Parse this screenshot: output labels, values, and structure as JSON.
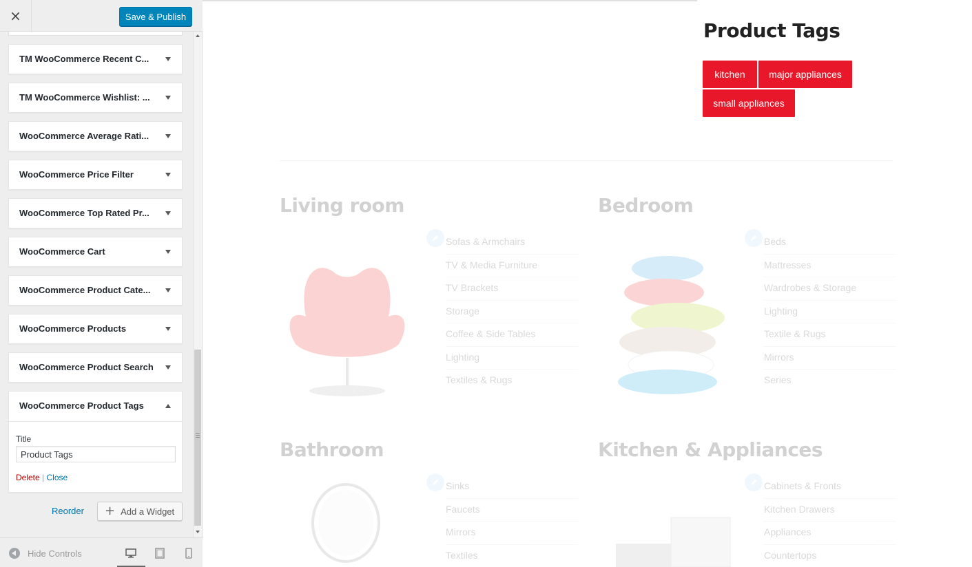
{
  "topbar": {
    "close_glyph": "×",
    "publish_label": "Save & Publish"
  },
  "widgets": [
    {
      "title": "TM WooCommerce Recent C..."
    },
    {
      "title": "TM WooCommerce Wishlist: ..."
    },
    {
      "title": "WooCommerce Average Rati..."
    },
    {
      "title": "WooCommerce Price Filter"
    },
    {
      "title": "WooCommerce Top Rated Pr..."
    },
    {
      "title": "WooCommerce Cart"
    },
    {
      "title": "WooCommerce Product Cate..."
    },
    {
      "title": "WooCommerce Products"
    },
    {
      "title": "WooCommerce Product Search"
    }
  ],
  "open_widget": {
    "title": "WooCommerce Product Tags",
    "field_label": "Title",
    "field_value": "Product Tags",
    "delete_label": "Delete",
    "separator": "|",
    "close_label": "Close"
  },
  "actions": {
    "reorder_label": "Reorder",
    "add_widget_label": "Add a Widget"
  },
  "footer": {
    "hide_controls_label": "Hide Controls"
  },
  "preview": {
    "widget_title": "Product Tags",
    "tags": [
      "kitchen",
      "major appliances",
      "small appliances"
    ],
    "tag_color": "#e8182a",
    "categories": [
      {
        "title": "Living room",
        "items": [
          "Sofas & Armchairs",
          "TV & Media Furniture",
          "TV Brackets",
          "Storage",
          "Coffee & Side Tables",
          "Lighting",
          "Textiles & Rugs"
        ]
      },
      {
        "title": "Bedroom",
        "items": [
          "Beds",
          "Mattresses",
          "Wardrobes & Storage",
          "Lighting",
          "Textile & Rugs",
          "Mirrors",
          "Series"
        ]
      },
      {
        "title": "Bathroom",
        "items": [
          "Sinks",
          "Faucets",
          "Mirrors",
          "Textiles"
        ]
      },
      {
        "title": "Kitchen & Appliances",
        "items": [
          "Cabinets & Fronts",
          "Kitchen Drawers",
          "Appliances",
          "Countertops"
        ]
      }
    ]
  },
  "colors": {
    "primary_button": "#0085ba",
    "link": "#0073aa",
    "delete": "#a00"
  }
}
